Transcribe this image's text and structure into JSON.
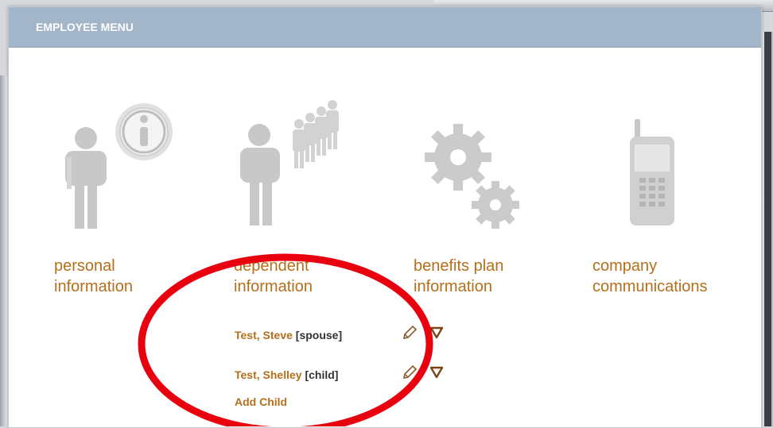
{
  "header": {
    "title": "EMPLOYEE MENU"
  },
  "tiles": [
    {
      "label_line1": "personal",
      "label_line2": "information",
      "icon": "person-info-icon"
    },
    {
      "label_line1": "dependent",
      "label_line2": "information",
      "icon": "person-group-icon"
    },
    {
      "label_line1": "benefits plan",
      "label_line2": "information",
      "icon": "gears-icon"
    },
    {
      "label_line1": "company",
      "label_line2": "communications",
      "icon": "cell-phone-icon"
    }
  ],
  "dependents": [
    {
      "name": "Test, Steve",
      "relation": "[spouse]"
    },
    {
      "name": "Test, Shelley",
      "relation": "[child]"
    }
  ],
  "add_child_label": "Add Child",
  "colors": {
    "accent": "#b46f1a",
    "header": "#a3b5c9",
    "highlight": "#e8000e"
  }
}
